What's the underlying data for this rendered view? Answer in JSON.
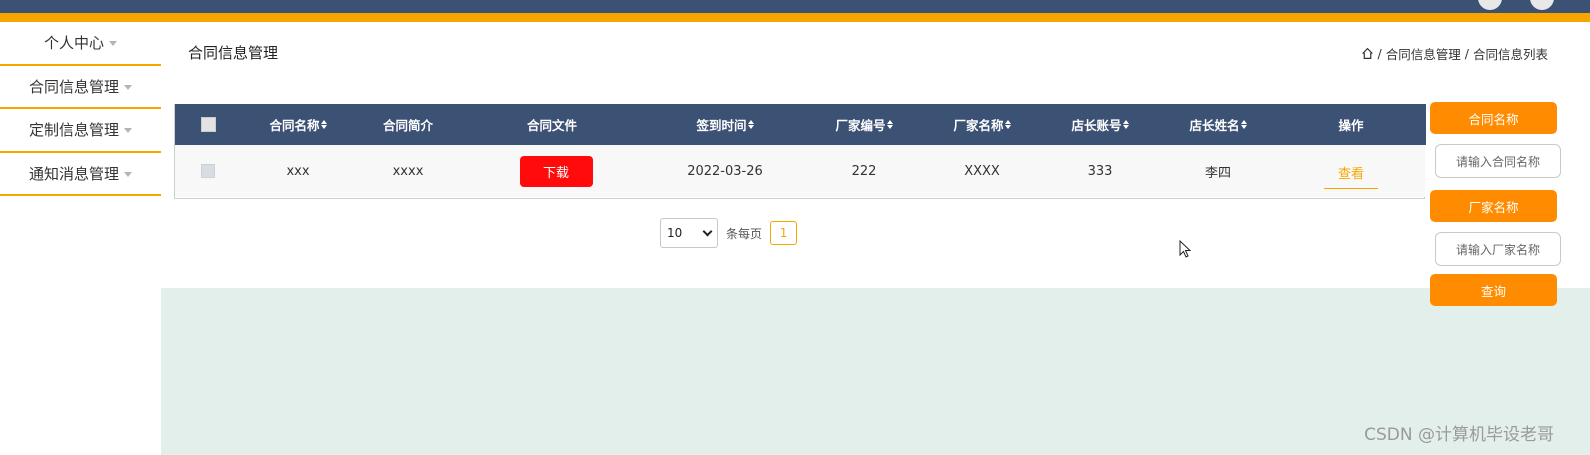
{
  "sidebar": {
    "items": [
      {
        "label": "个人中心"
      },
      {
        "label": "合同信息管理"
      },
      {
        "label": "定制信息管理"
      },
      {
        "label": "通知消息管理"
      }
    ]
  },
  "header": {
    "page_title": "合同信息管理",
    "breadcrumb": {
      "sep1": "/",
      "crumb1": "合同信息管理",
      "sep2": "/",
      "crumb2": "合同信息列表"
    }
  },
  "table": {
    "columns": [
      "合同名称",
      "合同简介",
      "合同文件",
      "签到时间",
      "厂家编号",
      "厂家名称",
      "店长账号",
      "店长姓名",
      "操作"
    ],
    "rows": [
      {
        "name": "xxx",
        "intro": "xxxx",
        "file_btn": "下载",
        "date": "2022-03-26",
        "factory_no": "222",
        "factory_name": "XXXX",
        "manager_account": "333",
        "manager_name": "李四",
        "action": "查看"
      }
    ]
  },
  "pagination": {
    "page_size": "10",
    "per_page_label": "条每页",
    "current_page": "1"
  },
  "search_panel": {
    "contract_name_label": "合同名称",
    "contract_name_placeholder": "请输入合同名称",
    "factory_name_label": "厂家名称",
    "factory_name_placeholder": "请输入厂家名称",
    "query_button": "查询"
  },
  "watermark": "CSDN @计算机毕设老哥",
  "colors": {
    "navy": "#3c5275",
    "accent": "#f7a600",
    "orange_button": "#ff8c00",
    "download_red": "#ff0b0b",
    "lower_bg": "#e3efeb"
  }
}
